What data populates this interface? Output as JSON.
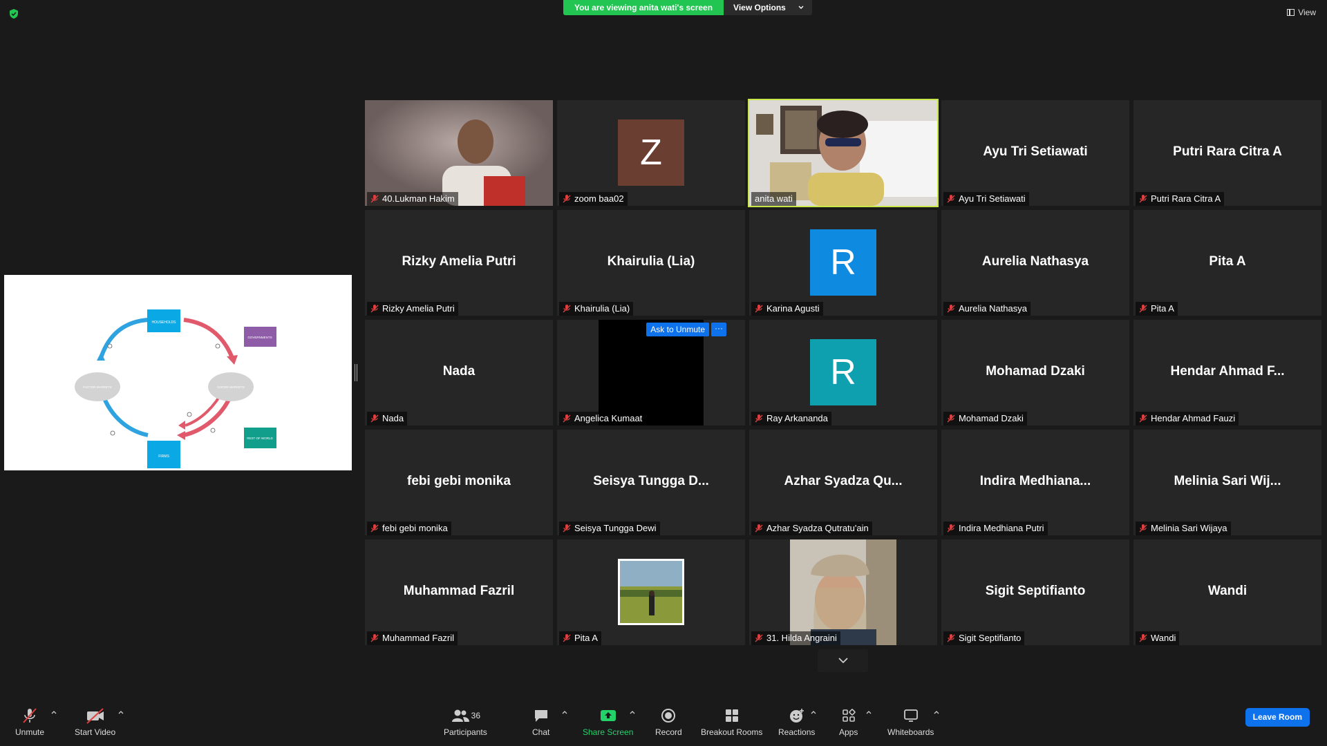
{
  "banner": {
    "viewing_text": "You are viewing anita wati's screen",
    "view_options_label": "View Options"
  },
  "view_label": "View",
  "shared_screen": {
    "nodes": [
      "HOUSEHOLDS",
      "FIRMS",
      "FACTOR MARKETS",
      "GOODS MARKETS",
      "GOVERNMENTS",
      "REST OF WORLD"
    ],
    "colors": {
      "households": "#0aa9e6",
      "firms": "#0aa9e6",
      "governments": "#8f5da8",
      "rest_of_world": "#119f8c",
      "blue_flow": "#2ea3e0",
      "red_flow": "#e05a6b",
      "markets": "#d3d3d3"
    }
  },
  "ask_to_unmute_label": "Ask to Unmute",
  "more_label": "···",
  "participants": [
    {
      "label": "40.Lukman Hakim",
      "type": "video"
    },
    {
      "label": "zoom baa02",
      "type": "avatar",
      "initial": "Z",
      "color": "#6b3e32"
    },
    {
      "label": "anita wati",
      "type": "video",
      "active": true
    },
    {
      "label": "Ayu Tri Setiawati",
      "display": "Ayu Tri Setiawati",
      "type": "name"
    },
    {
      "label": "Putri Rara Citra A",
      "display": "Putri Rara Citra A",
      "type": "name"
    },
    {
      "label": "Rizky Amelia Putri",
      "display": "Rizky Amelia Putri",
      "type": "name"
    },
    {
      "label": "Khairulia (Lia)",
      "display": "Khairulia (Lia)",
      "type": "name"
    },
    {
      "label": "Karina Agusti",
      "type": "avatar",
      "initial": "R",
      "color": "#0e8ae0"
    },
    {
      "label": "Aurelia Nathasya",
      "display": "Aurelia Nathasya",
      "type": "name"
    },
    {
      "label": "Pita A",
      "display": "Pita A",
      "type": "name"
    },
    {
      "label": "Nada",
      "display": "Nada",
      "type": "name"
    },
    {
      "label": "Angelica Kumaat",
      "type": "black"
    },
    {
      "label": "Ray Arkananda",
      "type": "avatar",
      "initial": "R",
      "color": "#0fa0b0"
    },
    {
      "label": "Mohamad Dzaki",
      "display": "Mohamad Dzaki",
      "type": "name"
    },
    {
      "label": "Hendar Ahmad Fauzi",
      "display": "Hendar Ahmad F...",
      "type": "name"
    },
    {
      "label": "febi gebi monika",
      "display": "febi gebi monika",
      "type": "name"
    },
    {
      "label": "Seisya Tungga Dewi",
      "display": "Seisya Tungga D...",
      "type": "name"
    },
    {
      "label": "Azhar Syadza Qutratu'ain",
      "display": "Azhar Syadza Qu...",
      "type": "name"
    },
    {
      "label": "Indira Medhiana Putri",
      "display": "Indira  Medhiana...",
      "type": "name"
    },
    {
      "label": "Melinia Sari Wijaya",
      "display": "Melinia  Sari  Wij...",
      "type": "name"
    },
    {
      "label": "Muhammad Fazril",
      "display": "Muhammad Fazril",
      "type": "name"
    },
    {
      "label": "Pita A",
      "type": "photo"
    },
    {
      "label": "31. Hilda Angraini",
      "type": "video"
    },
    {
      "label": "Sigit Septifianto",
      "display": "Sigit Septifianto",
      "type": "name"
    },
    {
      "label": "Wandi",
      "display": "Wandi",
      "type": "name"
    }
  ],
  "toolbar": {
    "unmute": "Unmute",
    "start_video": "Start Video",
    "participants": "Participants",
    "participant_count": "36",
    "chat": "Chat",
    "share_screen": "Share Screen",
    "record": "Record",
    "breakout_rooms": "Breakout Rooms",
    "reactions": "Reactions",
    "apps": "Apps",
    "whiteboards": "Whiteboards",
    "leave_room": "Leave Room"
  }
}
